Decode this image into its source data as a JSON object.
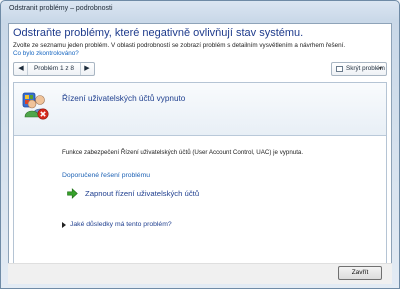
{
  "window": {
    "title": "Odstranit problémy – podrobnosti"
  },
  "header": {
    "heading": "Odstraňte problémy, které negativně ovlivňují stav systému.",
    "instruction": "Zvolte ze seznamu jeden problém. V oblasti podrobností se zobrazí problém s detailním vysvětlením a návrhem řešení.",
    "check_link": "Co bylo zkontrolováno?"
  },
  "toolbar": {
    "pager_label": "Problém 1 z 8",
    "prev_glyph": "◀",
    "next_glyph": "▶",
    "hide_problem_label": "Skrýt problém",
    "hide_chevron": "▼"
  },
  "problem": {
    "icon": "users-shield-error-icon",
    "title": "Řízení uživatelských účtů vypnuto",
    "description": "Funkce zabezpečení Řízení uživatelských účtů (User Account Control, UAC) je vypnuta.",
    "recommended_heading": "Doporučené řešení problému",
    "fix_label": "Zapnout řízení uživatelských účtů",
    "consequences_label": "Jaké důsledky má tento problém?"
  },
  "footer": {
    "close_label": "Zavřít"
  },
  "colors": {
    "heading_blue": "#1e3b8c",
    "link_blue": "#1565c0",
    "fix_arrow_green": "#36a12a",
    "error_red": "#d62a1e"
  }
}
